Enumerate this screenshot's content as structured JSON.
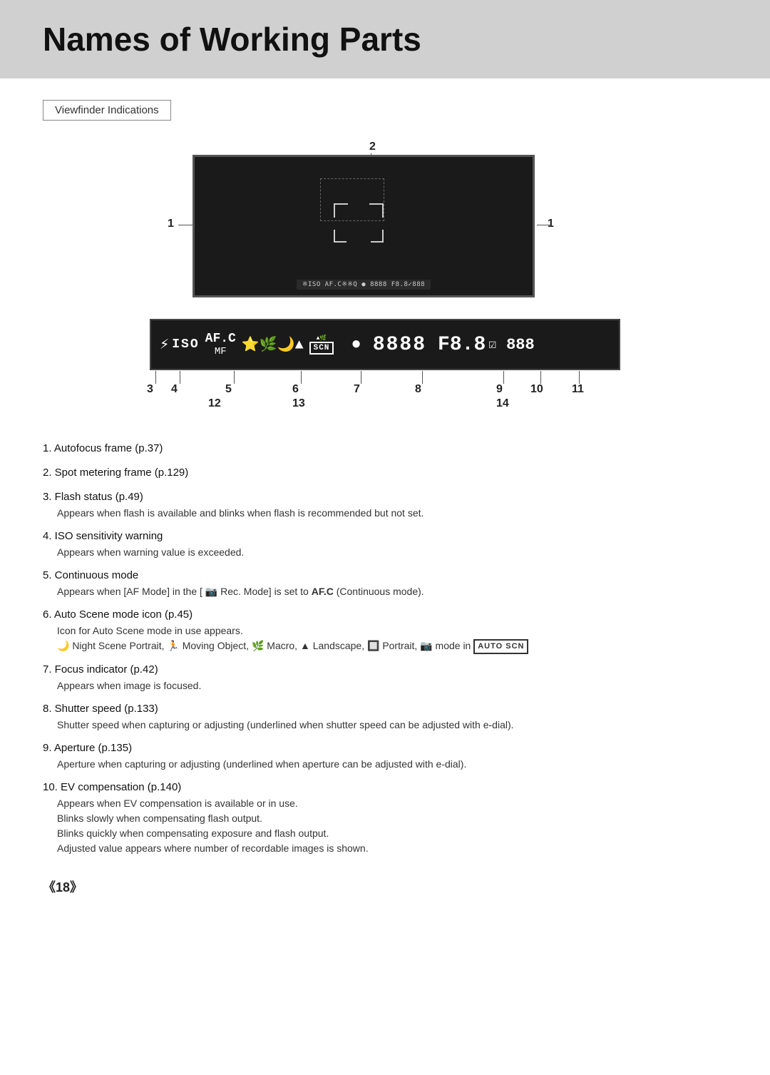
{
  "page": {
    "title": "Names of Working Parts",
    "section_label": "Viewfinder Indications",
    "page_number": "《18》"
  },
  "diagram": {
    "numbers": {
      "n1_left": "1",
      "n1_right": "1",
      "n2": "2",
      "n3": "3",
      "n4": "4",
      "n5": "5",
      "n6": "6",
      "n7": "7",
      "n8": "8",
      "n9": "9",
      "n10": "10",
      "n11": "11",
      "n12": "12",
      "n13": "13",
      "n14": "14"
    },
    "viewfinder_status": "※ISO AF.C※※Q ● 8888 F8.8✓888",
    "lcd_flash": "⚡",
    "lcd_iso": "ISO",
    "lcd_afc": "AF.C",
    "lcd_mf": "MF",
    "lcd_scene_icons": "🏔🌿🌙▲",
    "lcd_scn": "SCN",
    "lcd_dot": "●",
    "lcd_shutter": "8888",
    "lcd_aperture": "F8.8",
    "lcd_ev_icon": "☑",
    "lcd_shots": "888"
  },
  "items": [
    {
      "number": "1",
      "title": "Autofocus frame (p.37)",
      "sub": ""
    },
    {
      "number": "2",
      "title": "Spot metering frame (p.129)",
      "sub": ""
    },
    {
      "number": "3",
      "title": "Flash status (p.49)",
      "sub": "Appears when flash is available and blinks when flash is recommended but not set."
    },
    {
      "number": "4",
      "title": "ISO sensitivity warning",
      "sub": "Appears when warning value is exceeded."
    },
    {
      "number": "5",
      "title": "Continuous mode",
      "sub": "Appears when [AF Mode] in the [  Rec. Mode] is set to  AF.C (Continuous mode)."
    },
    {
      "number": "6",
      "title": "Auto Scene mode icon (p.45)",
      "sub": "Icon for Auto Scene mode in use appears.",
      "sub2": "🌙 Night Scene Portrait, 🏃 Moving Object, 🌿 Macro, ▲ Landscape, 🔲 Portrait, 📷 mode in AUTO SCN"
    },
    {
      "number": "7",
      "title": "Focus indicator (p.42)",
      "sub": "Appears when image is focused."
    },
    {
      "number": "8",
      "title": "Shutter speed (p.133)",
      "sub": "Shutter speed when capturing or adjusting (underlined when shutter speed can be adjusted with e-dial)."
    },
    {
      "number": "9",
      "title": "Aperture (p.135)",
      "sub": "Aperture when capturing or adjusting (underlined when aperture can be adjusted with e-dial)."
    },
    {
      "number": "10",
      "title": "EV compensation (p.140)",
      "sub": "Appears when EV compensation is available or in use.",
      "sub3": "Blinks slowly when compensating flash output.",
      "sub4": "Blinks quickly when compensating exposure and flash output.",
      "sub5": "Adjusted value appears where number of recordable images is shown."
    },
    {
      "number": "11",
      "title": "",
      "sub": ""
    }
  ]
}
